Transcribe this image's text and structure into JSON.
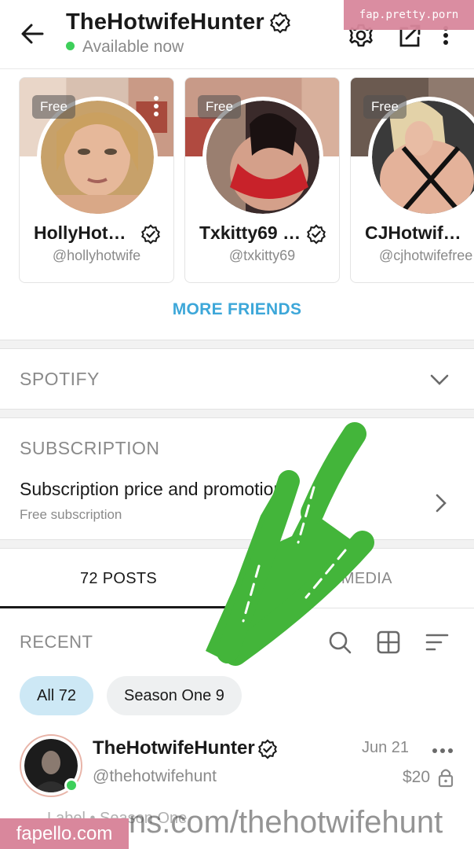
{
  "header": {
    "title": "TheHotwifeHunter",
    "status": "Available now"
  },
  "watermark_top": "fap.pretty.porn",
  "friends": [
    {
      "name": "HollyHot…",
      "handle": "@hollyhotwife",
      "badge": "Free"
    },
    {
      "name": "Txkitty69 …",
      "handle": "@txkitty69",
      "badge": "Free"
    },
    {
      "name": "CJHotwif…",
      "handle": "@cjhotwifefree",
      "badge": "Free"
    }
  ],
  "more_friends": "MORE FRIENDS",
  "spotify": {
    "title": "SPOTIFY"
  },
  "subscription": {
    "title": "SUBSCRIPTION",
    "main": "Subscription price and promotions",
    "sub": "Free subscription"
  },
  "tabs": {
    "posts": "72 POSTS",
    "media": "72 MEDIA"
  },
  "recent": {
    "title": "RECENT"
  },
  "filters": {
    "all": "All 72",
    "season": "Season One 9"
  },
  "post": {
    "name": "TheHotwifeHunter",
    "handle": "@thehotwifehunt",
    "date": "Jun 21",
    "price": "$20",
    "tag": "Label • Season One"
  },
  "overlay_url": "ns.com/thehotwifehunt",
  "watermark_bottom": "fapello.com",
  "colors": {
    "accent": "#3da7d9",
    "online": "#3ecf5a",
    "watermark": "#d9879c",
    "arrow": "#43b53a"
  }
}
